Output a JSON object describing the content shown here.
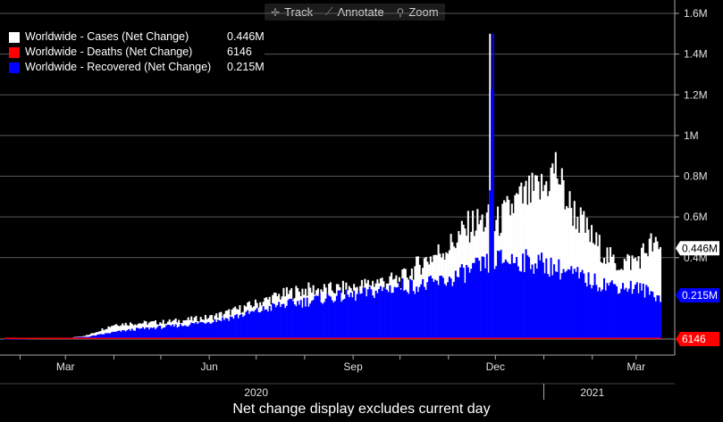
{
  "toolbar": {
    "items": [
      {
        "label": "Track",
        "icon": "crosshair-icon"
      },
      {
        "label": "Annotate",
        "icon": "pencil-icon"
      },
      {
        "label": "Zoom",
        "icon": "magnifier-icon"
      }
    ]
  },
  "footer_note": "Net change display excludes current day",
  "colors": {
    "cases": "#ffffff",
    "deaths": "#ff0000",
    "recovered": "#0000ff",
    "background": "#000000"
  },
  "chart_data": {
    "type": "bar",
    "title": "",
    "xlabel": "",
    "ylabel": "",
    "ylim": [
      -0.2,
      1.6
    ],
    "y_ticks": [
      {
        "value": 0.4,
        "label": "0.4M"
      },
      {
        "value": 0.6,
        "label": "0.6M"
      },
      {
        "value": 0.8,
        "label": "0.8M"
      },
      {
        "value": 1.0,
        "label": "1M"
      },
      {
        "value": 1.2,
        "label": "1.2M"
      },
      {
        "value": 1.4,
        "label": "1.4M"
      },
      {
        "value": 1.6,
        "label": "1.6M"
      }
    ],
    "x_month_labels": [
      {
        "date": "2020-03-01",
        "label": "Mar"
      },
      {
        "date": "2020-06-01",
        "label": "Jun"
      },
      {
        "date": "2020-09-01",
        "label": "Sep"
      },
      {
        "date": "2020-12-01",
        "label": "Dec"
      },
      {
        "date": "2021-03-01",
        "label": "Mar"
      }
    ],
    "x_year_labels": [
      {
        "date": "2020-07-01",
        "label": "2020"
      },
      {
        "date": "2021-02-01",
        "label": "2021"
      }
    ],
    "x_range": [
      "2020-01-22",
      "2021-03-16"
    ],
    "legend_position": "top-left",
    "series": [
      {
        "name": "Worldwide - Cases (Net Change)",
        "last_value_label": "0.446M",
        "color": "#ffffff",
        "points": [
          [
            "2020-01-22",
            0
          ],
          [
            "2020-02-01",
            0.002
          ],
          [
            "2020-02-15",
            0.003
          ],
          [
            "2020-03-01",
            0.003
          ],
          [
            "2020-03-15",
            0.02
          ],
          [
            "2020-04-01",
            0.075
          ],
          [
            "2020-04-15",
            0.08
          ],
          [
            "2020-05-01",
            0.085
          ],
          [
            "2020-05-15",
            0.095
          ],
          [
            "2020-06-01",
            0.11
          ],
          [
            "2020-06-15",
            0.14
          ],
          [
            "2020-07-01",
            0.18
          ],
          [
            "2020-07-15",
            0.22
          ],
          [
            "2020-08-01",
            0.25
          ],
          [
            "2020-08-15",
            0.25
          ],
          [
            "2020-09-01",
            0.26
          ],
          [
            "2020-09-15",
            0.29
          ],
          [
            "2020-10-01",
            0.3
          ],
          [
            "2020-10-15",
            0.39
          ],
          [
            "2020-11-01",
            0.47
          ],
          [
            "2020-11-15",
            0.58
          ],
          [
            "2020-11-26",
            0.6
          ],
          [
            "2020-11-27",
            1.5
          ],
          [
            "2020-11-28",
            0.55
          ],
          [
            "2020-12-01",
            0.58
          ],
          [
            "2020-12-15",
            0.7
          ],
          [
            "2020-12-31",
            0.76
          ],
          [
            "2021-01-08",
            0.87
          ],
          [
            "2021-01-15",
            0.7
          ],
          [
            "2021-02-01",
            0.5
          ],
          [
            "2021-02-15",
            0.38
          ],
          [
            "2021-03-01",
            0.4
          ],
          [
            "2021-03-10",
            0.48
          ],
          [
            "2021-03-16",
            0.446
          ]
        ]
      },
      {
        "name": "Worldwide - Deaths (Net Change)",
        "last_value_label": "6146",
        "color": "#ff0000",
        "points": [
          [
            "2020-01-22",
            0
          ],
          [
            "2020-03-01",
            0
          ],
          [
            "2020-04-15",
            0.007
          ],
          [
            "2020-07-01",
            0.005
          ],
          [
            "2020-10-01",
            0.006
          ],
          [
            "2021-01-15",
            0.014
          ],
          [
            "2021-03-16",
            0.006146
          ]
        ]
      },
      {
        "name": "Worldwide - Recovered (Net Change)",
        "last_value_label": "0.215M",
        "color": "#0000ff",
        "points": [
          [
            "2020-01-22",
            0
          ],
          [
            "2020-02-01",
            0.001
          ],
          [
            "2020-03-01",
            0.005
          ],
          [
            "2020-03-15",
            0.012
          ],
          [
            "2020-04-01",
            0.035
          ],
          [
            "2020-04-15",
            0.05
          ],
          [
            "2020-05-01",
            0.06
          ],
          [
            "2020-05-15",
            0.07
          ],
          [
            "2020-06-01",
            0.09
          ],
          [
            "2020-06-15",
            0.11
          ],
          [
            "2020-07-01",
            0.14
          ],
          [
            "2020-07-15",
            0.17
          ],
          [
            "2020-08-01",
            0.19
          ],
          [
            "2020-08-15",
            0.21
          ],
          [
            "2020-09-01",
            0.22
          ],
          [
            "2020-09-15",
            0.24
          ],
          [
            "2020-10-01",
            0.27
          ],
          [
            "2020-10-15",
            0.27
          ],
          [
            "2020-11-01",
            0.3
          ],
          [
            "2020-11-15",
            0.35
          ],
          [
            "2020-11-26",
            0.38
          ],
          [
            "2020-11-29",
            1.5
          ],
          [
            "2020-11-30",
            0.4
          ],
          [
            "2020-12-15",
            0.4
          ],
          [
            "2021-01-01",
            0.38
          ],
          [
            "2021-01-15",
            0.34
          ],
          [
            "2021-02-01",
            0.29
          ],
          [
            "2021-02-15",
            0.27
          ],
          [
            "2021-03-01",
            0.26
          ],
          [
            "2021-03-16",
            0.215
          ]
        ]
      }
    ]
  }
}
